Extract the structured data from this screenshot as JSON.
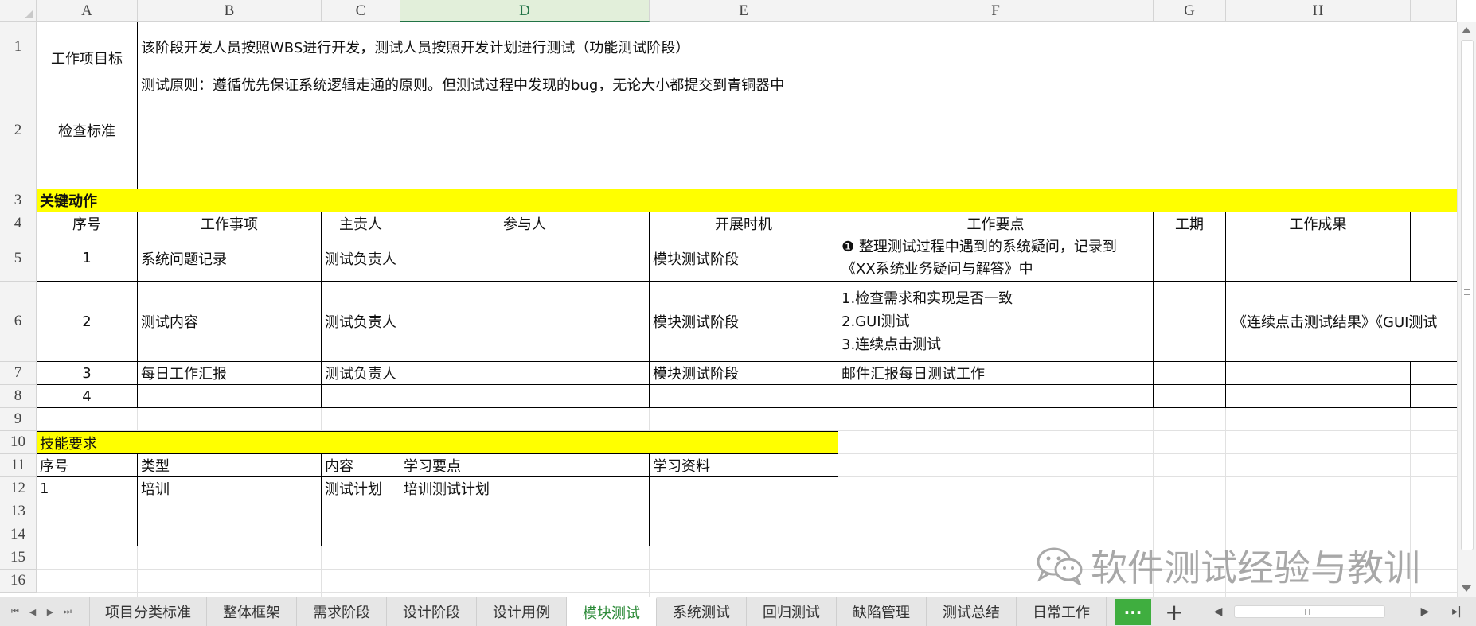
{
  "columns": [
    "A",
    "B",
    "C",
    "D",
    "E",
    "F",
    "G",
    "H"
  ],
  "selected_column": "D",
  "rows": [
    "1",
    "2",
    "3",
    "4",
    "5",
    "6",
    "7",
    "8",
    "9",
    "10",
    "11",
    "12",
    "13",
    "14",
    "15",
    "16"
  ],
  "row1": {
    "label": "工作项目标",
    "value": "该阶段开发人员按照WBS进行开发，测试人员按照开发计划进行测试（功能测试阶段）"
  },
  "row2": {
    "label": "检查标准",
    "value": "测试原则：遵循优先保证系统逻辑走通的原则。但测试过程中发现的bug，无论大小都提交到青铜器中"
  },
  "key_actions": {
    "title": "关键动作",
    "headers": [
      "序号",
      "工作事项",
      "主责人",
      "参与人",
      "开展时机",
      "工作要点",
      "工期",
      "工作成果"
    ],
    "rows": [
      {
        "no": "1",
        "item": "系统问题记录",
        "owner": "测试负责人",
        "participants": "",
        "timing": "模块测试阶段",
        "points": "❶ 整理测试过程中遇到的系统疑问，记录到《XX系统业务疑问与解答》中",
        "duration": "",
        "result": ""
      },
      {
        "no": "2",
        "item": "测试内容",
        "owner": "测试负责人",
        "participants": "",
        "timing": "模块测试阶段",
        "points_lines": [
          "1.检查需求和实现是否一致",
          "2.GUI测试",
          "3.连续点击测试"
        ],
        "duration": "",
        "result": "《连续点击测试结果》《GUI测试"
      },
      {
        "no": "3",
        "item": "每日工作汇报",
        "owner": "测试负责人",
        "participants": "",
        "timing": "模块测试阶段",
        "points": "邮件汇报每日测试工作",
        "duration": "",
        "result": ""
      },
      {
        "no": "4",
        "item": "",
        "owner": "",
        "participants": "",
        "timing": "",
        "points": "",
        "duration": "",
        "result": ""
      }
    ]
  },
  "skills": {
    "title": "技能要求",
    "headers": [
      "序号",
      "类型",
      "内容",
      "学习要点",
      "学习资料"
    ],
    "rows": [
      {
        "no": "1",
        "type": "培训",
        "content": "测试计划",
        "points": "培训测试计划",
        "material": ""
      }
    ]
  },
  "sheet_tabs": [
    "项目分类标准",
    "整体框架",
    "需求阶段",
    "设计阶段",
    "设计用例",
    "模块测试",
    "系统测试",
    "回归测试",
    "缺陷管理",
    "测试总结",
    "日常工作"
  ],
  "active_tab": "模块测试",
  "more_label": "···",
  "add_label": "+",
  "watermark": "软件测试经验与教训",
  "colors": {
    "yellow": "#ffff00",
    "accent": "#217346",
    "tab_active": "#2e8b3a",
    "more_btn": "#3fae3f"
  }
}
